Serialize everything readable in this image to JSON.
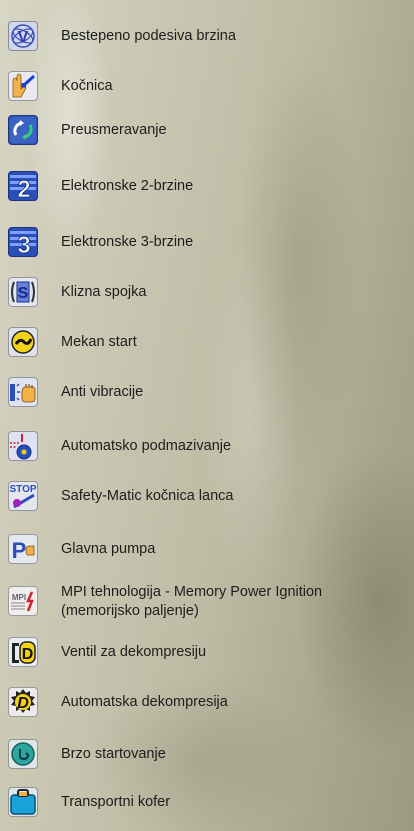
{
  "features": [
    {
      "icon": "variable-speed-icon",
      "label": "Bestepeno podesiva brzina"
    },
    {
      "icon": "brake-icon",
      "label": "Kočnica"
    },
    {
      "icon": "reverse-icon",
      "label": "Preusmeravanje"
    },
    {
      "icon": "electronic-2-speed-icon",
      "label": "Elektronske 2-brzine"
    },
    {
      "icon": "electronic-3-speed-icon",
      "label": "Elektronske 3-brzine"
    },
    {
      "icon": "slip-clutch-icon",
      "label": "Klizna spojka"
    },
    {
      "icon": "soft-start-icon",
      "label": "Mekan start"
    },
    {
      "icon": "anti-vibration-icon",
      "label": "Anti vibracije"
    },
    {
      "icon": "auto-lubrication-icon",
      "label": "Automatsko podmazivanje"
    },
    {
      "icon": "chain-brake-stop-icon",
      "label": "Safety-Matic kočnica lanca"
    },
    {
      "icon": "primer-pump-icon",
      "label": "Glavna pumpa"
    },
    {
      "icon": "mpi-ignition-icon",
      "label": "MPI tehnologija - Memory Power Ignition",
      "label2": "(memorijsko paljenje)"
    },
    {
      "icon": "decompression-valve-icon",
      "label": "Ventil za dekompresiju"
    },
    {
      "icon": "auto-decompression-icon",
      "label": "Automatska dekompresija"
    },
    {
      "icon": "easy-start-icon",
      "label": "Brzo startovanje"
    },
    {
      "icon": "carrying-case-icon",
      "label": "Transportni kofer"
    }
  ],
  "icon_text": {
    "v": "V",
    "two": "2",
    "three": "3",
    "s": "S",
    "stop": "STOP",
    "p": "P",
    "mpi": "MPI",
    "d": "D"
  }
}
